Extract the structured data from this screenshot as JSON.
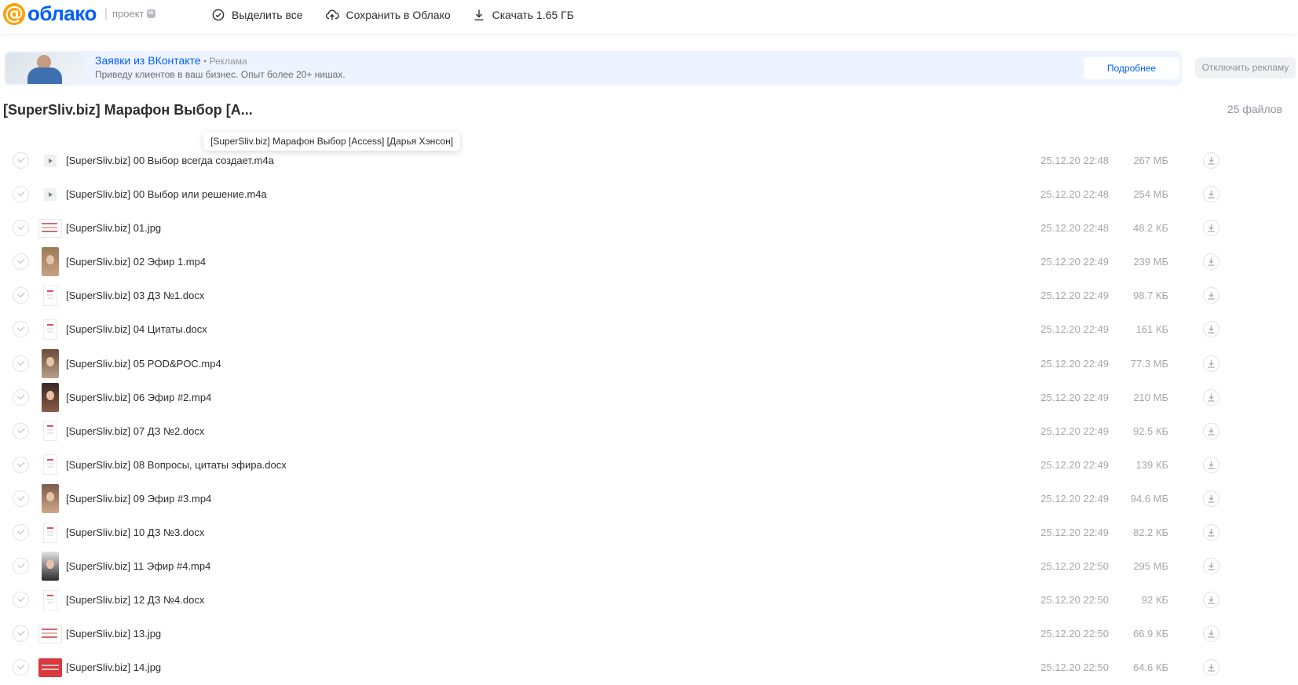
{
  "header": {
    "logo_text": "облако",
    "project_label": "проект",
    "toolbar": {
      "select_all": "Выделить все",
      "save_to_cloud": "Сохранить в Облако",
      "download": "Скачать 1.65 ГБ"
    }
  },
  "ad": {
    "title": "Заявки из ВКонтакте",
    "label": " • Реклама",
    "subtitle": "Приведу клиентов в ваш бизнес. Опыт более 20+ нишах.",
    "more_button": "Подробнее",
    "disable_button": "Отключить рекламу"
  },
  "folder": {
    "title": "[SuperSliv.biz] Марафон Выбор [A...",
    "count": "25 файлов",
    "tooltip": "[SuperSliv.biz] Марафон Выбор [Access] [Дарья Хэнсон]"
  },
  "files": [
    {
      "name": "[SuperSliv.biz] 00 Выбор всегда создает.m4a",
      "date": "25.12.20 22:48",
      "size": "267 МБ",
      "type": "audio"
    },
    {
      "name": "[SuperSliv.biz] 00 Выбор или решение.m4a",
      "date": "25.12.20 22:48",
      "size": "254 МБ",
      "type": "audio"
    },
    {
      "name": "[SuperSliv.biz] 01.jpg",
      "date": "25.12.20 22:48",
      "size": "48.2 КБ",
      "type": "jpgw"
    },
    {
      "name": "[SuperSliv.biz] 02 Эфир 1.mp4",
      "date": "25.12.20 22:49",
      "size": "239 МБ",
      "type": "video v1"
    },
    {
      "name": "[SuperSliv.biz] 03 ДЗ №1.docx",
      "date": "25.12.20 22:49",
      "size": "98.7 КБ",
      "type": "doc"
    },
    {
      "name": "[SuperSliv.biz] 04 Цитаты.docx",
      "date": "25.12.20 22:49",
      "size": "161 КБ",
      "type": "doc"
    },
    {
      "name": "[SuperSliv.biz] 05 POD&POC.mp4",
      "date": "25.12.20 22:49",
      "size": "77.3 МБ",
      "type": "video v2"
    },
    {
      "name": "[SuperSliv.biz] 06 Эфир #2.mp4",
      "date": "25.12.20 22:49",
      "size": "210 МБ",
      "type": "video v3"
    },
    {
      "name": "[SuperSliv.biz] 07 ДЗ №2.docx",
      "date": "25.12.20 22:49",
      "size": "92.5 КБ",
      "type": "doc"
    },
    {
      "name": "[SuperSliv.biz] 08 Вопросы, цитаты эфира.docx",
      "date": "25.12.20 22:49",
      "size": "139 КБ",
      "type": "doc"
    },
    {
      "name": "[SuperSliv.biz] 09 Эфир #3.mp4",
      "date": "25.12.20 22:49",
      "size": "94.6 МБ",
      "type": "video v4"
    },
    {
      "name": "[SuperSliv.biz] 10 ДЗ №3.docx",
      "date": "25.12.20 22:49",
      "size": "82.2 КБ",
      "type": "doc"
    },
    {
      "name": "[SuperSliv.biz] 11 Эфир #4.mp4",
      "date": "25.12.20 22:50",
      "size": "295 МБ",
      "type": "video v5"
    },
    {
      "name": "[SuperSliv.biz] 12 ДЗ №4.docx",
      "date": "25.12.20 22:50",
      "size": "92 КБ",
      "type": "doc"
    },
    {
      "name": "[SuperSliv.biz] 13.jpg",
      "date": "25.12.20 22:50",
      "size": "66.9 КБ",
      "type": "jpgw"
    },
    {
      "name": "[SuperSliv.biz] 14.jpg",
      "date": "25.12.20 22:50",
      "size": "64.6 КБ",
      "type": "jpgr"
    }
  ]
}
